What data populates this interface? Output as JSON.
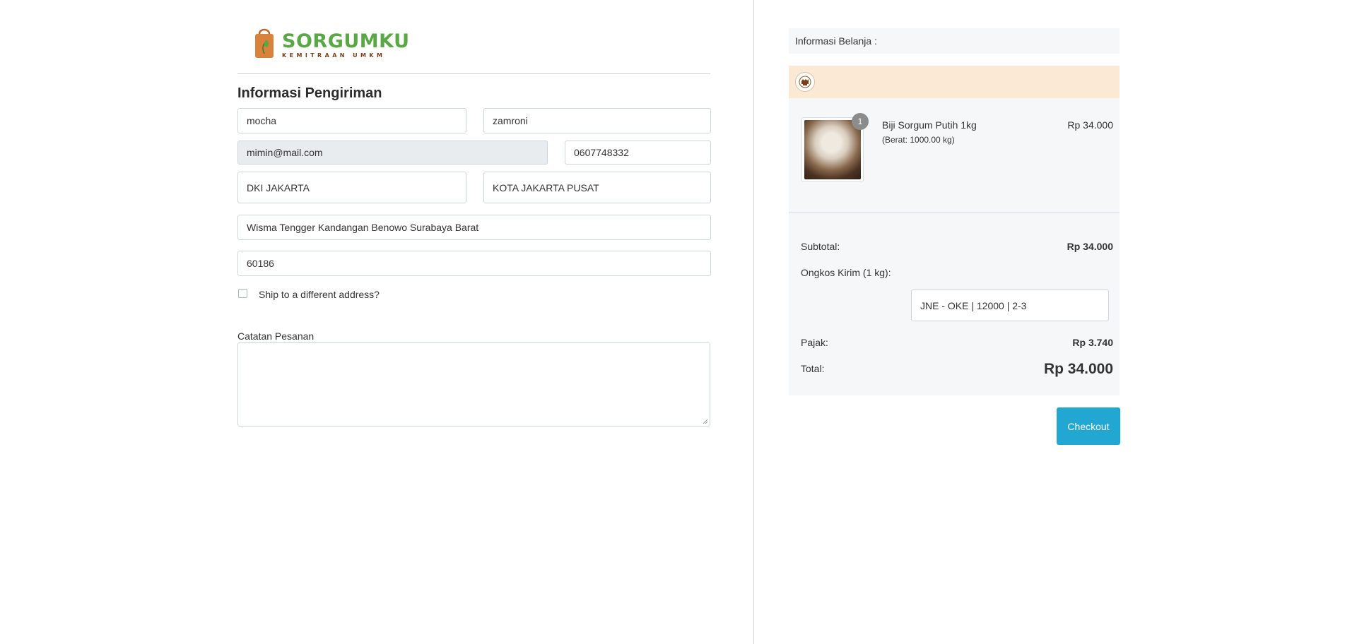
{
  "brand": {
    "name": "SORGUMKU",
    "tagline": "KEMITRAAN UMKM",
    "colors": {
      "green": "#5aa845",
      "bag": "#d9823b",
      "brown": "#7a3e1a"
    }
  },
  "shipping_form": {
    "title": "Informasi Pengiriman",
    "first_name": "mocha",
    "last_name": "zamroni",
    "email": "mimin@mail.com",
    "phone": "0607748332",
    "province": "DKI JAKARTA",
    "city": "KOTA JAKARTA PUSAT",
    "address": "Wisma Tengger Kandangan Benowo Surabaya Barat",
    "postal_code": "60186",
    "ship_different_label": "Ship to a different address?",
    "ship_different_checked": false,
    "notes_label": "Catatan Pesanan",
    "notes_value": ""
  },
  "summary": {
    "header": "Informasi Belanja :",
    "store_icon": "store-logo-icon",
    "items": [
      {
        "name": "Biji Sorgum Putih 1kg",
        "weight": "(Berat: 1000.00 kg)",
        "price": "Rp 34.000",
        "qty": "1"
      }
    ],
    "subtotal_label": "Subtotal:",
    "subtotal_value": "Rp 34.000",
    "shipping_label": "Ongkos Kirim (1 kg):",
    "shipping_option": "JNE - OKE | 12000 | 2-3",
    "tax_label": "Pajak:",
    "tax_value": "Rp 3.740",
    "total_label": "Total:",
    "total_value": "Rp 34.000",
    "checkout_label": "Checkout",
    "colors": {
      "store_bar": "#fbe9d5",
      "panel": "#f6f7f9",
      "checkout": "#22a6d2"
    }
  }
}
